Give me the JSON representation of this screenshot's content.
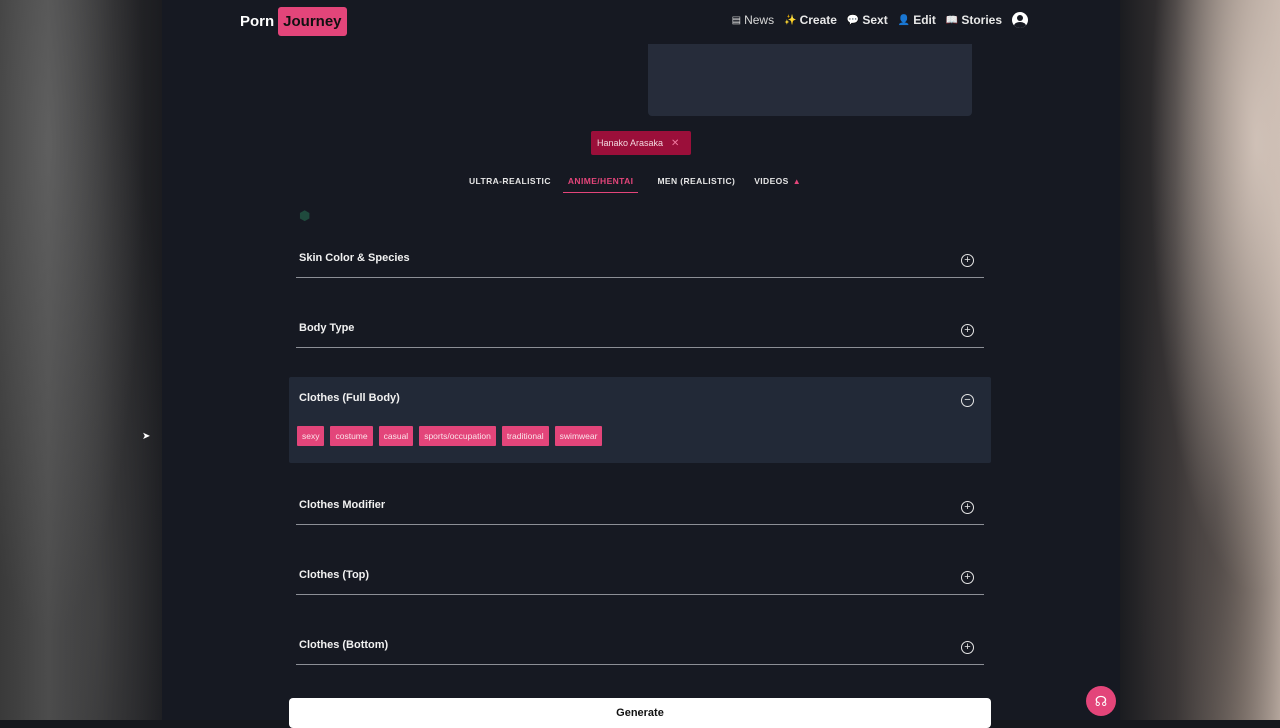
{
  "brand": {
    "part1": "Porn",
    "part2": "Journey",
    "accent": "#e3457a"
  },
  "nav": [
    {
      "label": "News",
      "icon": "newspaper-icon",
      "glyph": "▤"
    },
    {
      "label": "Create",
      "icon": "sparkle-icon",
      "glyph": "✨"
    },
    {
      "label": "Sext",
      "icon": "chat-icon",
      "glyph": "💬"
    },
    {
      "label": "Edit",
      "icon": "person-icon",
      "glyph": "👤"
    },
    {
      "label": "Stories",
      "icon": "book-icon",
      "glyph": "📖"
    }
  ],
  "selected_character": {
    "label": "Hanako Arasaka",
    "remove": "✕"
  },
  "tabs": [
    {
      "label": "ULTRA-REALISTIC",
      "active": false
    },
    {
      "label": "ANIME/HENTAI",
      "active": true
    },
    {
      "label": "MEN (REALISTIC)",
      "active": false
    },
    {
      "label": "VIDEOS",
      "active": false,
      "icon": "flame-icon"
    }
  ],
  "sections": {
    "skin": {
      "title": "Skin Color & Species",
      "toggle": "+"
    },
    "body": {
      "title": "Body Type",
      "toggle": "+"
    },
    "clothes_full": {
      "title": "Clothes (Full Body)",
      "toggle": "−",
      "options": [
        "sexy",
        "costume",
        "casual",
        "sports/occupation",
        "traditional",
        "swimwear"
      ]
    },
    "modifier": {
      "title": "Clothes Modifier",
      "toggle": "+"
    },
    "top": {
      "title": "Clothes (Top)",
      "toggle": "+"
    },
    "bottom": {
      "title": "Clothes (Bottom)",
      "toggle": "+"
    }
  },
  "generate_label": "Generate"
}
